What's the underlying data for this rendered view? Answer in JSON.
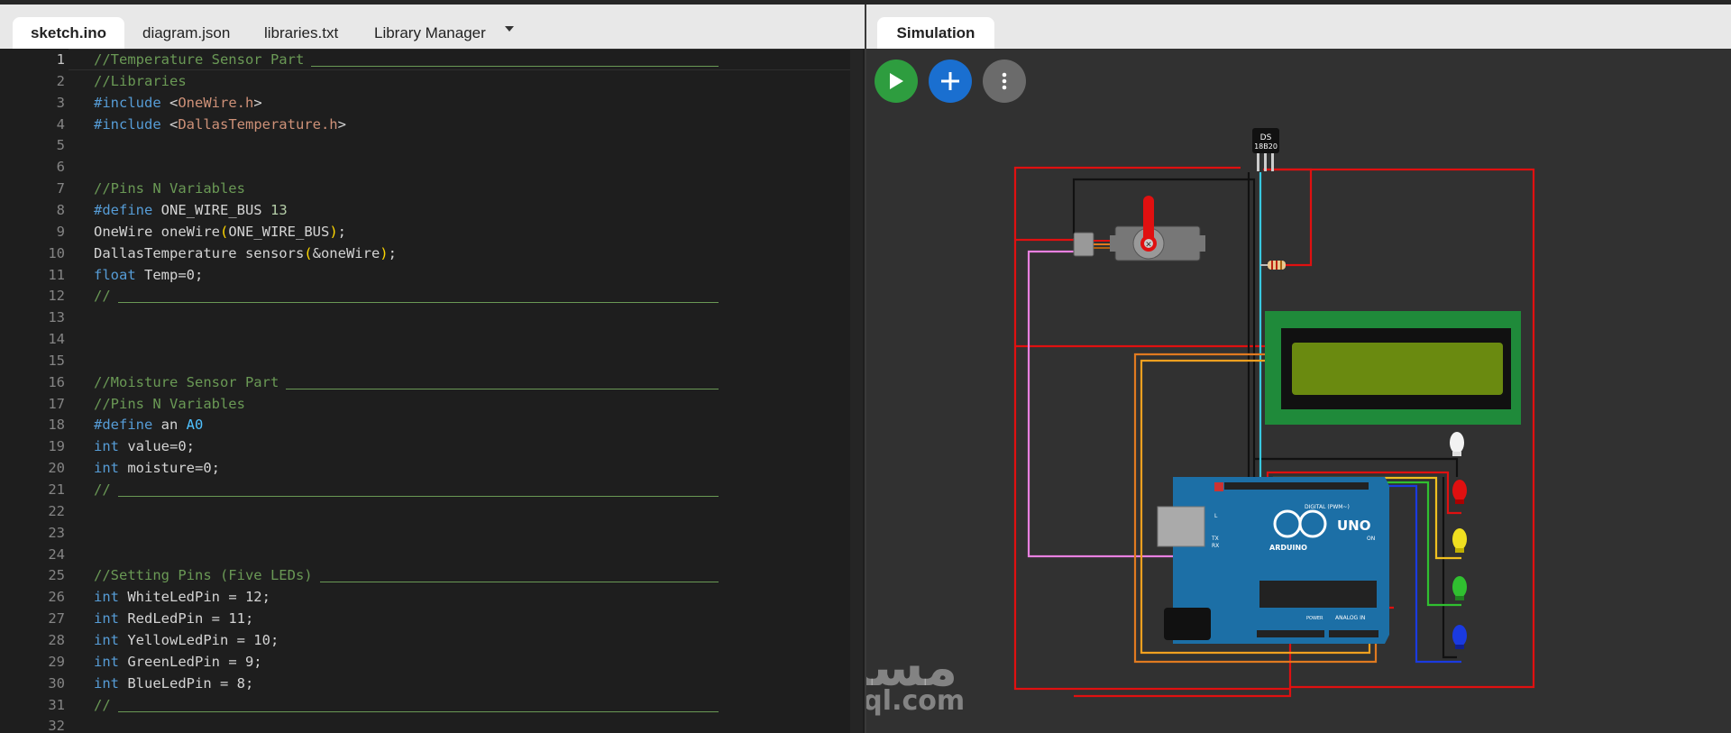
{
  "tabs": {
    "left": [
      {
        "label": "sketch.ino",
        "active": true
      },
      {
        "label": "diagram.json",
        "active": false
      },
      {
        "label": "libraries.txt",
        "active": false
      },
      {
        "label": "Library Manager",
        "active": false
      }
    ],
    "right": [
      {
        "label": "Simulation",
        "active": true
      }
    ]
  },
  "editor": {
    "current_line": 1,
    "lines": [
      {
        "n": "1",
        "tokens": [
          {
            "t": "comment",
            "v": "//Temperature Sensor Part"
          }
        ],
        "rule": true
      },
      {
        "n": "2",
        "tokens": [
          {
            "t": "comment",
            "v": "//Libraries"
          }
        ]
      },
      {
        "n": "3",
        "tokens": [
          {
            "t": "kw",
            "v": "#include"
          },
          {
            "t": "plain",
            "v": " <"
          },
          {
            "t": "str",
            "v": "OneWire.h"
          },
          {
            "t": "plain",
            "v": ">"
          }
        ]
      },
      {
        "n": "4",
        "tokens": [
          {
            "t": "kw",
            "v": "#include"
          },
          {
            "t": "plain",
            "v": " <"
          },
          {
            "t": "str",
            "v": "DallasTemperature.h"
          },
          {
            "t": "plain",
            "v": ">"
          }
        ]
      },
      {
        "n": "5",
        "tokens": []
      },
      {
        "n": "6",
        "tokens": []
      },
      {
        "n": "7",
        "tokens": [
          {
            "t": "comment",
            "v": "//Pins N Variables"
          }
        ]
      },
      {
        "n": "8",
        "tokens": [
          {
            "t": "kw",
            "v": "#define"
          },
          {
            "t": "plain",
            "v": " ONE_WIRE_BUS "
          },
          {
            "t": "num",
            "v": "13"
          }
        ]
      },
      {
        "n": "9",
        "tokens": [
          {
            "t": "plain",
            "v": "OneWire oneWire"
          },
          {
            "t": "paren",
            "v": "("
          },
          {
            "t": "plain",
            "v": "ONE_WIRE_BUS"
          },
          {
            "t": "paren",
            "v": ")"
          },
          {
            "t": "plain",
            "v": ";"
          }
        ]
      },
      {
        "n": "10",
        "tokens": [
          {
            "t": "plain",
            "v": "DallasTemperature sensors"
          },
          {
            "t": "paren",
            "v": "("
          },
          {
            "t": "plain",
            "v": "&oneWire"
          },
          {
            "t": "paren",
            "v": ")"
          },
          {
            "t": "plain",
            "v": ";"
          }
        ]
      },
      {
        "n": "11",
        "tokens": [
          {
            "t": "kw",
            "v": "float"
          },
          {
            "t": "plain",
            "v": " Temp=0;"
          }
        ]
      },
      {
        "n": "12",
        "tokens": [
          {
            "t": "comment",
            "v": "//"
          }
        ],
        "rule": true
      },
      {
        "n": "13",
        "tokens": []
      },
      {
        "n": "14",
        "tokens": []
      },
      {
        "n": "15",
        "tokens": []
      },
      {
        "n": "16",
        "tokens": [
          {
            "t": "comment",
            "v": "//Moisture Sensor Part"
          }
        ],
        "rule": true
      },
      {
        "n": "17",
        "tokens": [
          {
            "t": "comment",
            "v": "//Pins N Variables"
          }
        ]
      },
      {
        "n": "18",
        "tokens": [
          {
            "t": "kw",
            "v": "#define"
          },
          {
            "t": "plain",
            "v": " an "
          },
          {
            "t": "const",
            "v": "A0"
          }
        ]
      },
      {
        "n": "19",
        "tokens": [
          {
            "t": "kw",
            "v": "int"
          },
          {
            "t": "plain",
            "v": " value=0;"
          }
        ]
      },
      {
        "n": "20",
        "tokens": [
          {
            "t": "kw",
            "v": "int"
          },
          {
            "t": "plain",
            "v": " moisture=0;"
          }
        ]
      },
      {
        "n": "21",
        "tokens": [
          {
            "t": "comment",
            "v": "//"
          }
        ],
        "rule": true
      },
      {
        "n": "22",
        "tokens": []
      },
      {
        "n": "23",
        "tokens": []
      },
      {
        "n": "24",
        "tokens": []
      },
      {
        "n": "25",
        "tokens": [
          {
            "t": "comment",
            "v": "//Setting Pins (Five LEDs)"
          }
        ],
        "rule": true
      },
      {
        "n": "26",
        "tokens": [
          {
            "t": "kw",
            "v": "int"
          },
          {
            "t": "plain",
            "v": " WhiteLedPin = 12;"
          }
        ]
      },
      {
        "n": "27",
        "tokens": [
          {
            "t": "kw",
            "v": "int"
          },
          {
            "t": "plain",
            "v": " RedLedPin = 11;"
          }
        ]
      },
      {
        "n": "28",
        "tokens": [
          {
            "t": "kw",
            "v": "int"
          },
          {
            "t": "plain",
            "v": " YellowLedPin = 10;"
          }
        ]
      },
      {
        "n": "29",
        "tokens": [
          {
            "t": "kw",
            "v": "int"
          },
          {
            "t": "plain",
            "v": " GreenLedPin = 9;"
          }
        ]
      },
      {
        "n": "30",
        "tokens": [
          {
            "t": "kw",
            "v": "int"
          },
          {
            "t": "plain",
            "v": " BlueLedPin = 8;"
          }
        ]
      },
      {
        "n": "31",
        "tokens": [
          {
            "t": "comment",
            "v": "//"
          }
        ],
        "rule": true
      },
      {
        "n": "32",
        "tokens": []
      }
    ]
  },
  "simulation": {
    "buttons": [
      {
        "name": "play-button",
        "icon": "play-icon",
        "color": "#2e9d3f"
      },
      {
        "name": "add-part-button",
        "icon": "plus-icon",
        "color": "#1a6fd0"
      },
      {
        "name": "more-options-button",
        "icon": "kebab-icon",
        "color": "#6b6b6b"
      }
    ],
    "parts": {
      "sensor_label_1": "DS",
      "sensor_label_2": "18B20",
      "board_model": "UNO",
      "board_brand": "ARDUINO",
      "digital_label": "DIGITAL (PWM~)",
      "analog_label": "ANALOG IN",
      "power_label": "POWER",
      "on_label": "ON",
      "tx_label": "TX",
      "rx_label": "RX",
      "l_label": "L",
      "aref_label": "AREF",
      "gnd_label": "GND"
    },
    "colors": {
      "wire_red": "#e01010",
      "wire_black": "#111111",
      "wire_cyan": "#38c8e0",
      "wire_pink": "#e880e0",
      "wire_orange": "#e07a20",
      "wire_yellow": "#f0c020",
      "wire_green": "#30c030",
      "wire_blue": "#1a3ae0",
      "lcd_board": "#1f8a3a",
      "lcd_screen": "#6a8a10",
      "arduino": "#1c6fa6"
    }
  },
  "watermark": {
    "arabic": "مستقل",
    "latin": "mostaql.com"
  }
}
